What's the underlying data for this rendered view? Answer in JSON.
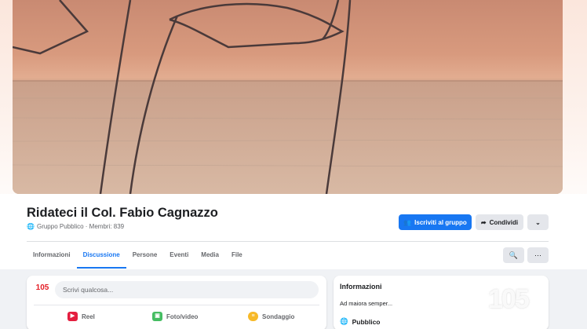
{
  "group": {
    "name": "Ridateci il Col. Fabio Cagnazzo",
    "meta": "Gruppo Pubblico · Membri: 839"
  },
  "actions": {
    "join_label": "Iscriviti al gruppo",
    "share_label": "Condividi"
  },
  "tabs": [
    {
      "label": "Informazioni"
    },
    {
      "label": "Discussione",
      "active": true
    },
    {
      "label": "Persone"
    },
    {
      "label": "Eventi"
    },
    {
      "label": "Media"
    },
    {
      "label": "File"
    }
  ],
  "composer": {
    "avatar_text": "105",
    "placeholder": "Scrivi qualcosa...",
    "reel_label": "Reel",
    "photo_label": "Foto/video",
    "poll_label": "Sondaggio"
  },
  "about": {
    "title": "Informazioni",
    "description": "Ad maiora semper...",
    "privacy": "Pubblico"
  },
  "watermark": "105",
  "colors": {
    "primary": "#1877f2",
    "reel": "#e41e3f",
    "photo": "#45bd62",
    "poll": "#f7b928"
  }
}
